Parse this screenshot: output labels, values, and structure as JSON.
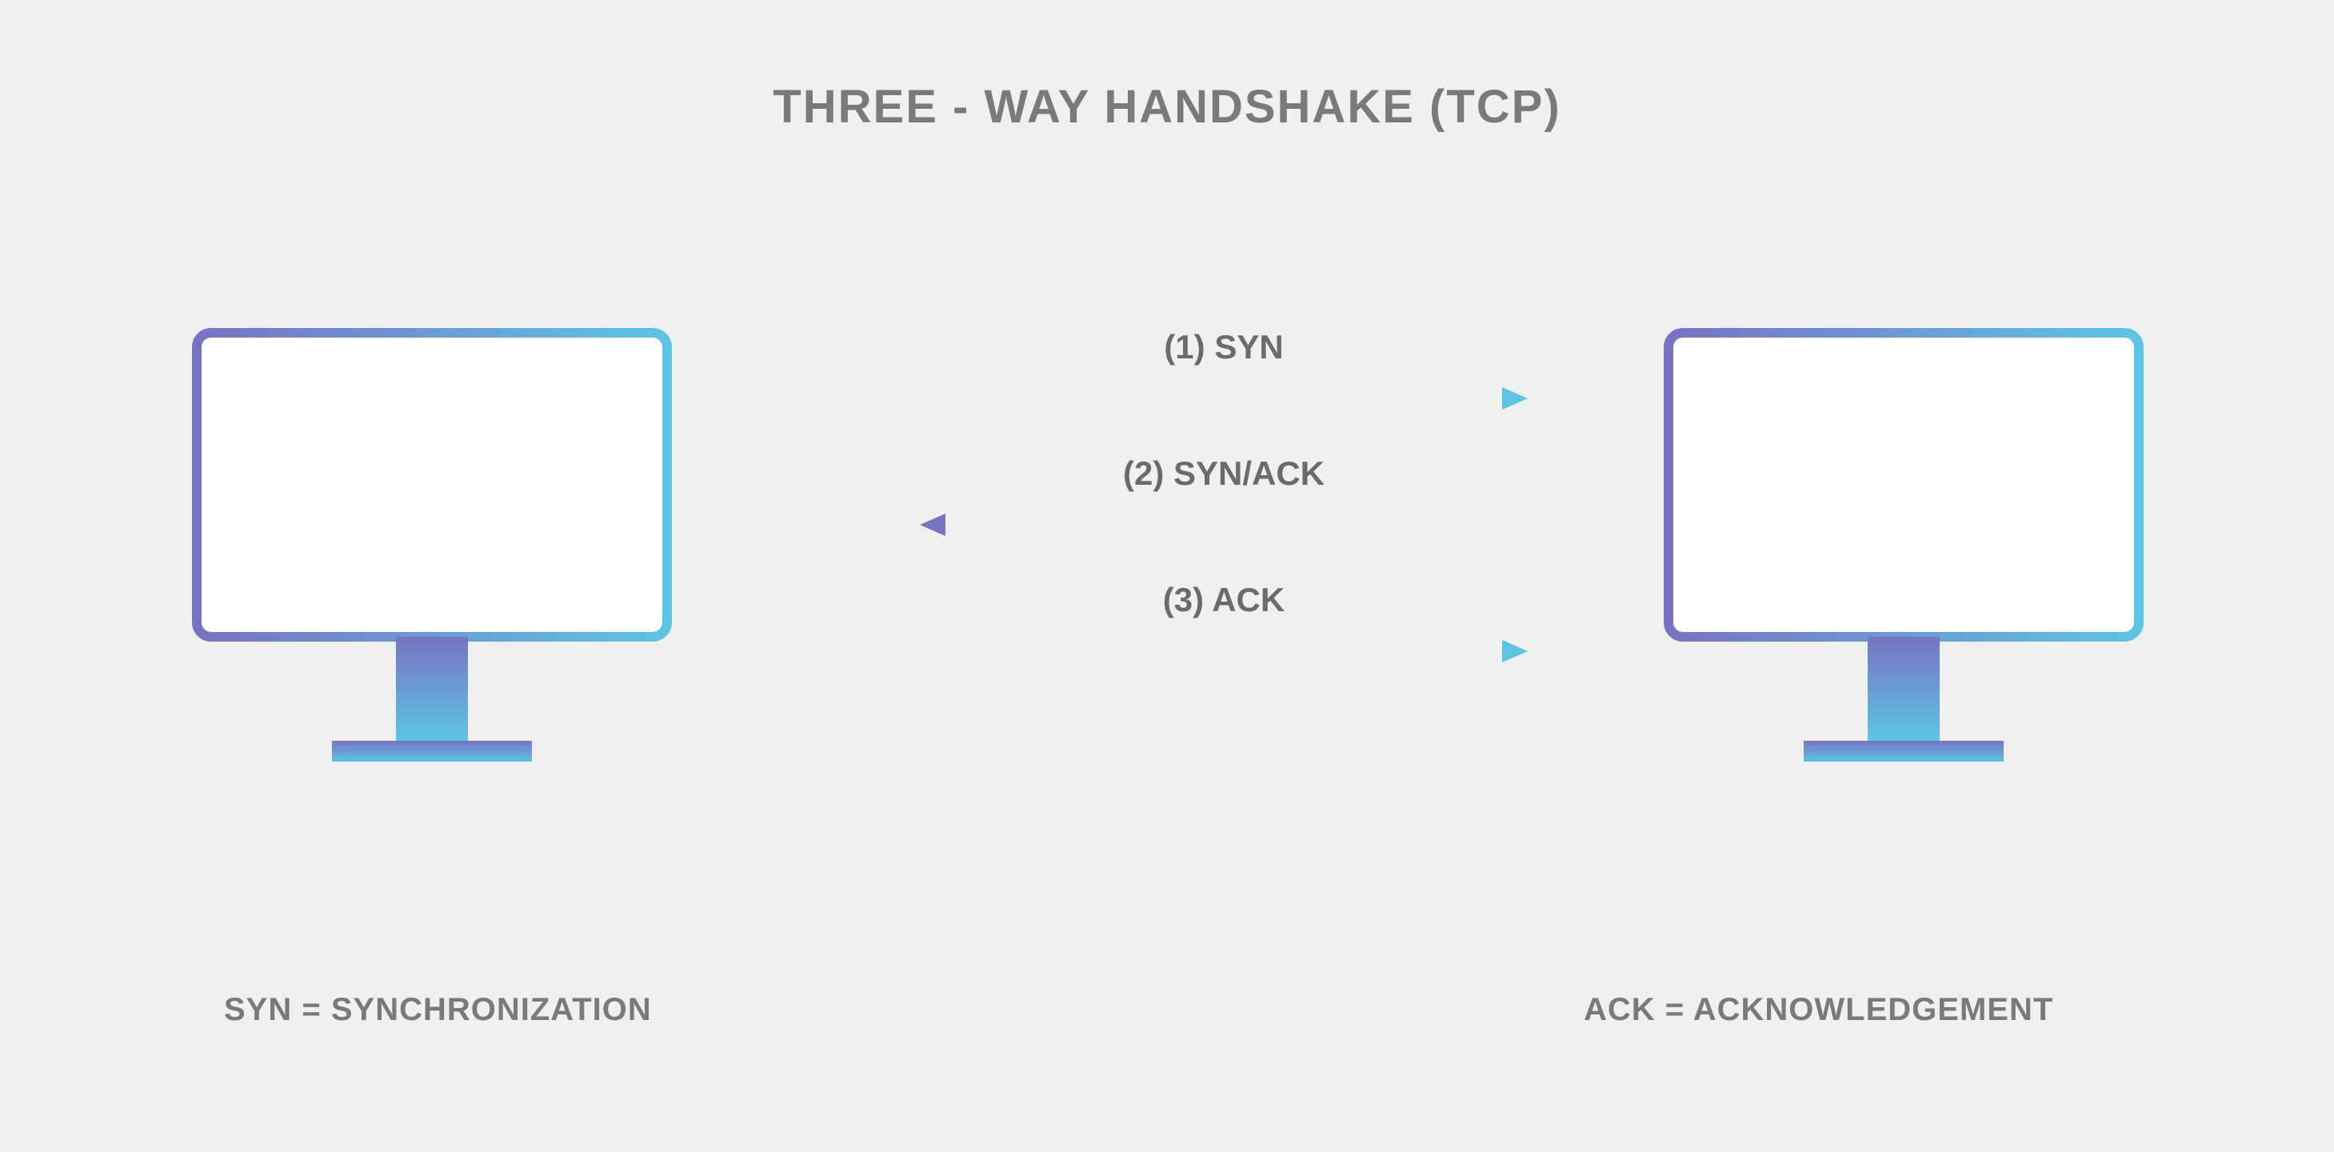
{
  "title": "THREE - WAY HANDSHAKE (TCP)",
  "steps": [
    {
      "label": "(1) SYN",
      "direction": "right"
    },
    {
      "label": "(2) SYN/ACK",
      "direction": "left"
    },
    {
      "label": "(3) ACK",
      "direction": "right"
    }
  ],
  "legend": {
    "syn": "SYN = SYNCHRONIZATION",
    "ack": "ACK = ACKNOWLEDGEMENT"
  },
  "colors": {
    "purple": "#7872c4",
    "blue": "#5dc5e3",
    "text": "#7a7a7a",
    "bg": "#f0f0f0"
  }
}
